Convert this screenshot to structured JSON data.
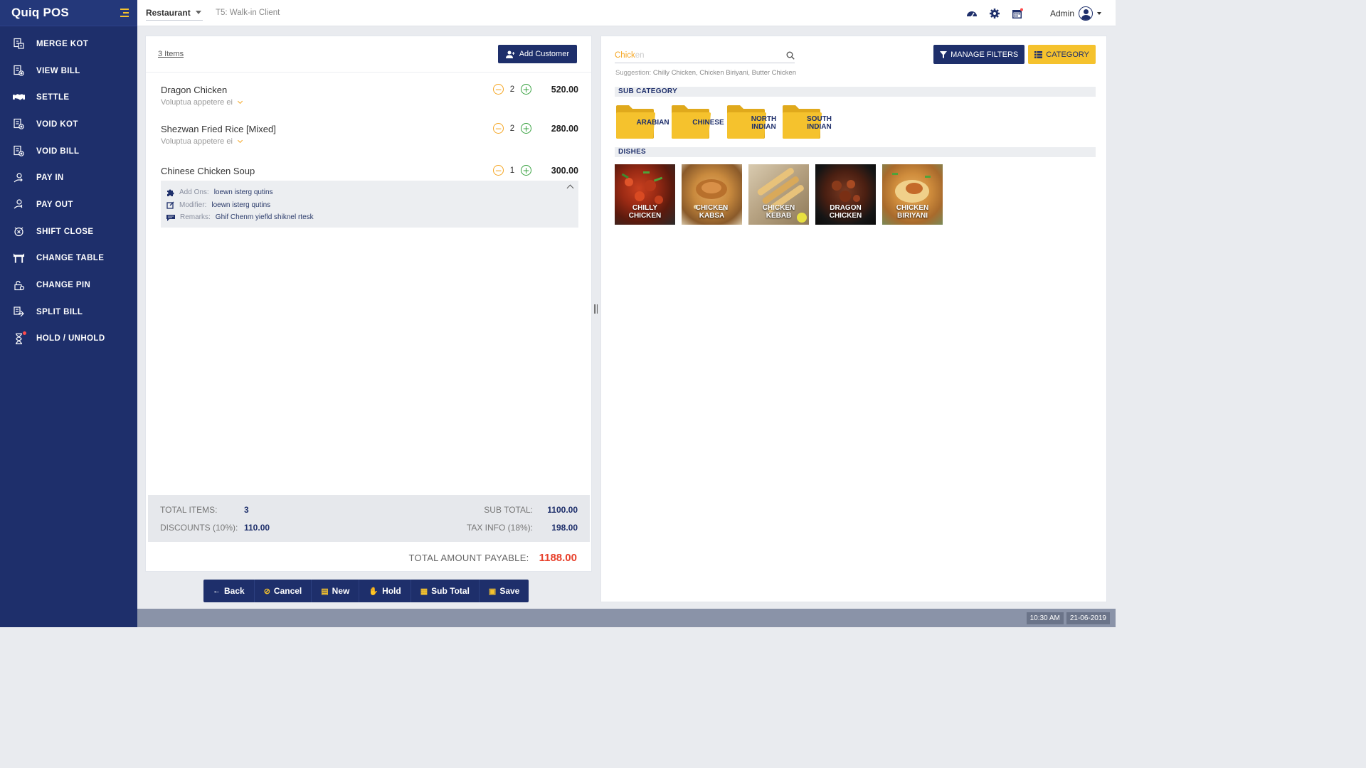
{
  "app": {
    "name": "Quiq POS"
  },
  "sidebar": {
    "items": [
      {
        "label": "MERGE KOT",
        "icon": "merge-kot-icon"
      },
      {
        "label": "VIEW BILL",
        "icon": "view-bill-icon"
      },
      {
        "label": "SETTLE",
        "icon": "handshake-icon"
      },
      {
        "label": "VOID KOT",
        "icon": "void-kot-icon"
      },
      {
        "label": "VOID BILL",
        "icon": "void-bill-icon"
      },
      {
        "label": "PAY IN",
        "icon": "pay-in-icon"
      },
      {
        "label": "PAY OUT",
        "icon": "pay-out-icon"
      },
      {
        "label": "SHIFT CLOSE",
        "icon": "shift-close-icon"
      },
      {
        "label": "CHANGE TABLE",
        "icon": "table-icon"
      },
      {
        "label": "CHANGE PIN",
        "icon": "lock-icon"
      },
      {
        "label": "SPLIT BILL",
        "icon": "split-bill-icon"
      },
      {
        "label": "HOLD / UNHOLD",
        "icon": "hourglass-icon"
      }
    ]
  },
  "topbar": {
    "location": "Restaurant",
    "client": "T5: Walk-in Client",
    "user": "Admin"
  },
  "order": {
    "items_count": "3 Items",
    "add_customer": "Add Customer",
    "lines": [
      {
        "name": "Dragon Chicken",
        "note": "Voluptua appetere ei",
        "qty": "2",
        "price": "520.00"
      },
      {
        "name": "Shezwan Fried Rice [Mixed]",
        "note": "Voluptua appetere ei",
        "qty": "2",
        "price": "280.00"
      },
      {
        "name": "Chinese Chicken Soup",
        "qty": "1",
        "price": "300.00"
      }
    ],
    "details": {
      "addons_label": "Add Ons:",
      "addons_value": "loewn isterg qutins",
      "modifier_label": "Modifier:",
      "modifier_value": "loewn isterg qutins",
      "remarks_label": "Remarks:",
      "remarks_value": "Ghif Chenm yiefld shiknel rtesk"
    },
    "totals": {
      "total_items_label": "TOTAL ITEMS:",
      "total_items": "3",
      "discounts_label": "DISCOUNTS (10%):",
      "discounts": "110.00",
      "subtotal_label": "SUB TOTAL:",
      "subtotal": "1100.00",
      "tax_label": "TAX INFO (18%):",
      "tax": "198.00",
      "payable_label": "TOTAL AMOUNT PAYABLE:",
      "payable": "1188.00"
    },
    "actions": {
      "back": "Back",
      "cancel": "Cancel",
      "new": "New",
      "hold": "Hold",
      "subtotal": "Sub Total",
      "save": "Save"
    }
  },
  "menu_panel": {
    "search_typed": "Chick",
    "search_ghost": "en",
    "suggestion_label": "Suggestion:",
    "suggestion_values": "Chilly Chicken, Chicken Biriyani, Butter Chicken",
    "manage_filters": "MANAGE FILTERS",
    "category": "CATEGORY",
    "sub_category_title": "SUB CATEGORY",
    "sub_categories": [
      {
        "line1": "ARABIAN",
        "line2": ""
      },
      {
        "line1": "CHINESE",
        "line2": ""
      },
      {
        "line1": "NORTH",
        "line2": "INDIAN"
      },
      {
        "line1": "SOUTH",
        "line2": "INDIAN"
      }
    ],
    "dishes_title": "DISHES",
    "dishes": [
      {
        "line1": "CHILLY",
        "line2": "CHICKEN"
      },
      {
        "line1": "CHICKEN",
        "line2": "KABSA"
      },
      {
        "line1": "CHICKEN",
        "line2": "KEBAB"
      },
      {
        "line1": "DRAGON",
        "line2": "CHICKEN"
      },
      {
        "line1": "CHICKEN",
        "line2": "BIRIYANI"
      }
    ]
  },
  "status": {
    "time": "10:30 AM",
    "date": "21-06-2019"
  },
  "colors": {
    "navy": "#1e2f6b",
    "accent_yellow": "#f5c22d",
    "payable_red": "#e8412c",
    "plus_green": "#37a13f"
  }
}
